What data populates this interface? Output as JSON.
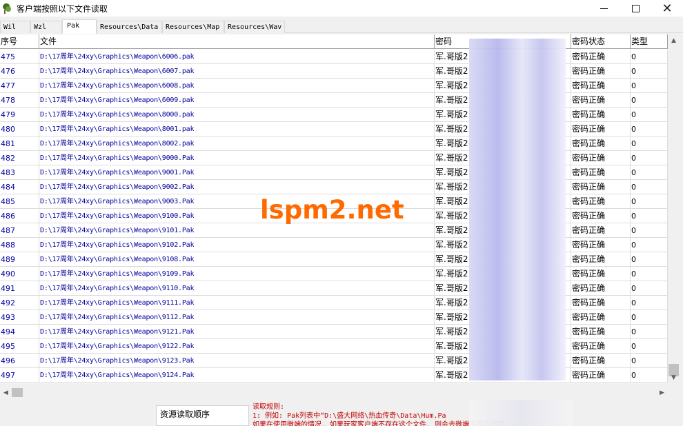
{
  "window": {
    "title": "客户端按照以下文件读取",
    "controls": {
      "minimize": "",
      "maximize": "",
      "close": "✕"
    }
  },
  "tabs": [
    {
      "label": "Wil",
      "active": false
    },
    {
      "label": "Wzl",
      "active": false
    },
    {
      "label": "Pak",
      "active": true
    },
    {
      "label": "Resources\\Data",
      "active": false
    },
    {
      "label": "Resources\\Map",
      "active": false
    },
    {
      "label": "Resources\\Wav",
      "active": false
    }
  ],
  "table": {
    "columns": [
      "序号",
      "文件",
      "密码",
      "密码状态",
      "类型"
    ],
    "rows": [
      {
        "idx": "475",
        "file": "D:\\17周年\\24xy\\Graphics\\Weapon\\6006.pak",
        "pwd": "军.哥版2",
        "status": "密码正确",
        "type": "0"
      },
      {
        "idx": "476",
        "file": "D:\\17周年\\24xy\\Graphics\\Weapon\\6007.pak",
        "pwd": "军.哥版2",
        "status": "密码正确",
        "type": "0"
      },
      {
        "idx": "477",
        "file": "D:\\17周年\\24xy\\Graphics\\Weapon\\6008.pak",
        "pwd": "军.哥版2",
        "status": "密码正确",
        "type": "0"
      },
      {
        "idx": "478",
        "file": "D:\\17周年\\24xy\\Graphics\\Weapon\\6009.pak",
        "pwd": "军.哥版2",
        "status": "密码正确",
        "type": "0"
      },
      {
        "idx": "479",
        "file": "D:\\17周年\\24xy\\Graphics\\Weapon\\8000.pak",
        "pwd": "军.哥版2",
        "status": "密码正确",
        "type": "0"
      },
      {
        "idx": "480",
        "file": "D:\\17周年\\24xy\\Graphics\\Weapon\\8001.pak",
        "pwd": "军.哥版2",
        "status": "密码正确",
        "type": "0"
      },
      {
        "idx": "481",
        "file": "D:\\17周年\\24xy\\Graphics\\Weapon\\8002.pak",
        "pwd": "军.哥版2",
        "status": "密码正确",
        "type": "0"
      },
      {
        "idx": "482",
        "file": "D:\\17周年\\24xy\\Graphics\\Weapon\\9000.Pak",
        "pwd": "军.哥版2",
        "status": "密码正确",
        "type": "0"
      },
      {
        "idx": "483",
        "file": "D:\\17周年\\24xy\\Graphics\\Weapon\\9001.Pak",
        "pwd": "军.哥版2",
        "status": "密码正确",
        "type": "0"
      },
      {
        "idx": "484",
        "file": "D:\\17周年\\24xy\\Graphics\\Weapon\\9002.Pak",
        "pwd": "军.哥版2",
        "status": "密码正确",
        "type": "0"
      },
      {
        "idx": "485",
        "file": "D:\\17周年\\24xy\\Graphics\\Weapon\\9003.Pak",
        "pwd": "军.哥版2",
        "status": "密码正确",
        "type": "0"
      },
      {
        "idx": "486",
        "file": "D:\\17周年\\24xy\\Graphics\\Weapon\\9100.Pak",
        "pwd": "军.哥版2",
        "status": "密码正确",
        "type": "0"
      },
      {
        "idx": "487",
        "file": "D:\\17周年\\24xy\\Graphics\\Weapon\\9101.Pak",
        "pwd": "军.哥版2",
        "status": "密码正确",
        "type": "0"
      },
      {
        "idx": "488",
        "file": "D:\\17周年\\24xy\\Graphics\\Weapon\\9102.Pak",
        "pwd": "军.哥版2",
        "status": "密码正确",
        "type": "0"
      },
      {
        "idx": "489",
        "file": "D:\\17周年\\24xy\\Graphics\\Weapon\\9108.Pak",
        "pwd": "军.哥版2",
        "status": "密码正确",
        "type": "0"
      },
      {
        "idx": "490",
        "file": "D:\\17周年\\24xy\\Graphics\\Weapon\\9109.Pak",
        "pwd": "军.哥版2",
        "status": "密码正确",
        "type": "0"
      },
      {
        "idx": "491",
        "file": "D:\\17周年\\24xy\\Graphics\\Weapon\\9110.Pak",
        "pwd": "军.哥版2",
        "status": "密码正确",
        "type": "0"
      },
      {
        "idx": "492",
        "file": "D:\\17周年\\24xy\\Graphics\\Weapon\\9111.Pak",
        "pwd": "军.哥版2",
        "status": "密码正确",
        "type": "0"
      },
      {
        "idx": "493",
        "file": "D:\\17周年\\24xy\\Graphics\\Weapon\\9112.Pak",
        "pwd": "军.哥版2",
        "status": "密码正确",
        "type": "0"
      },
      {
        "idx": "494",
        "file": "D:\\17周年\\24xy\\Graphics\\Weapon\\9121.Pak",
        "pwd": "军.哥版2",
        "status": "密码正确",
        "type": "0"
      },
      {
        "idx": "495",
        "file": "D:\\17周年\\24xy\\Graphics\\Weapon\\9122.Pak",
        "pwd": "军.哥版2",
        "status": "密码正确",
        "type": "0"
      },
      {
        "idx": "496",
        "file": "D:\\17周年\\24xy\\Graphics\\Weapon\\9123.Pak",
        "pwd": "军.哥版2",
        "status": "密码正确",
        "type": "0"
      },
      {
        "idx": "497",
        "file": "D:\\17周年\\24xy\\Graphics\\Weapon\\9124.Pak",
        "pwd": "军.哥版2",
        "status": "密码正确",
        "type": "0"
      }
    ]
  },
  "bottom": {
    "order_label": "资源读取顺序",
    "rules_lines": [
      "读取规则:",
      "1: 例如: Pak列表中“D:\\盛大网络\\热血传奇\\Data\\Hum.Pa",
      "   如果在使用微端的情况, 如果玩家客户端不存在这个文件, 则会去微端下载到读取."
    ]
  },
  "watermark": "lspm2.net"
}
